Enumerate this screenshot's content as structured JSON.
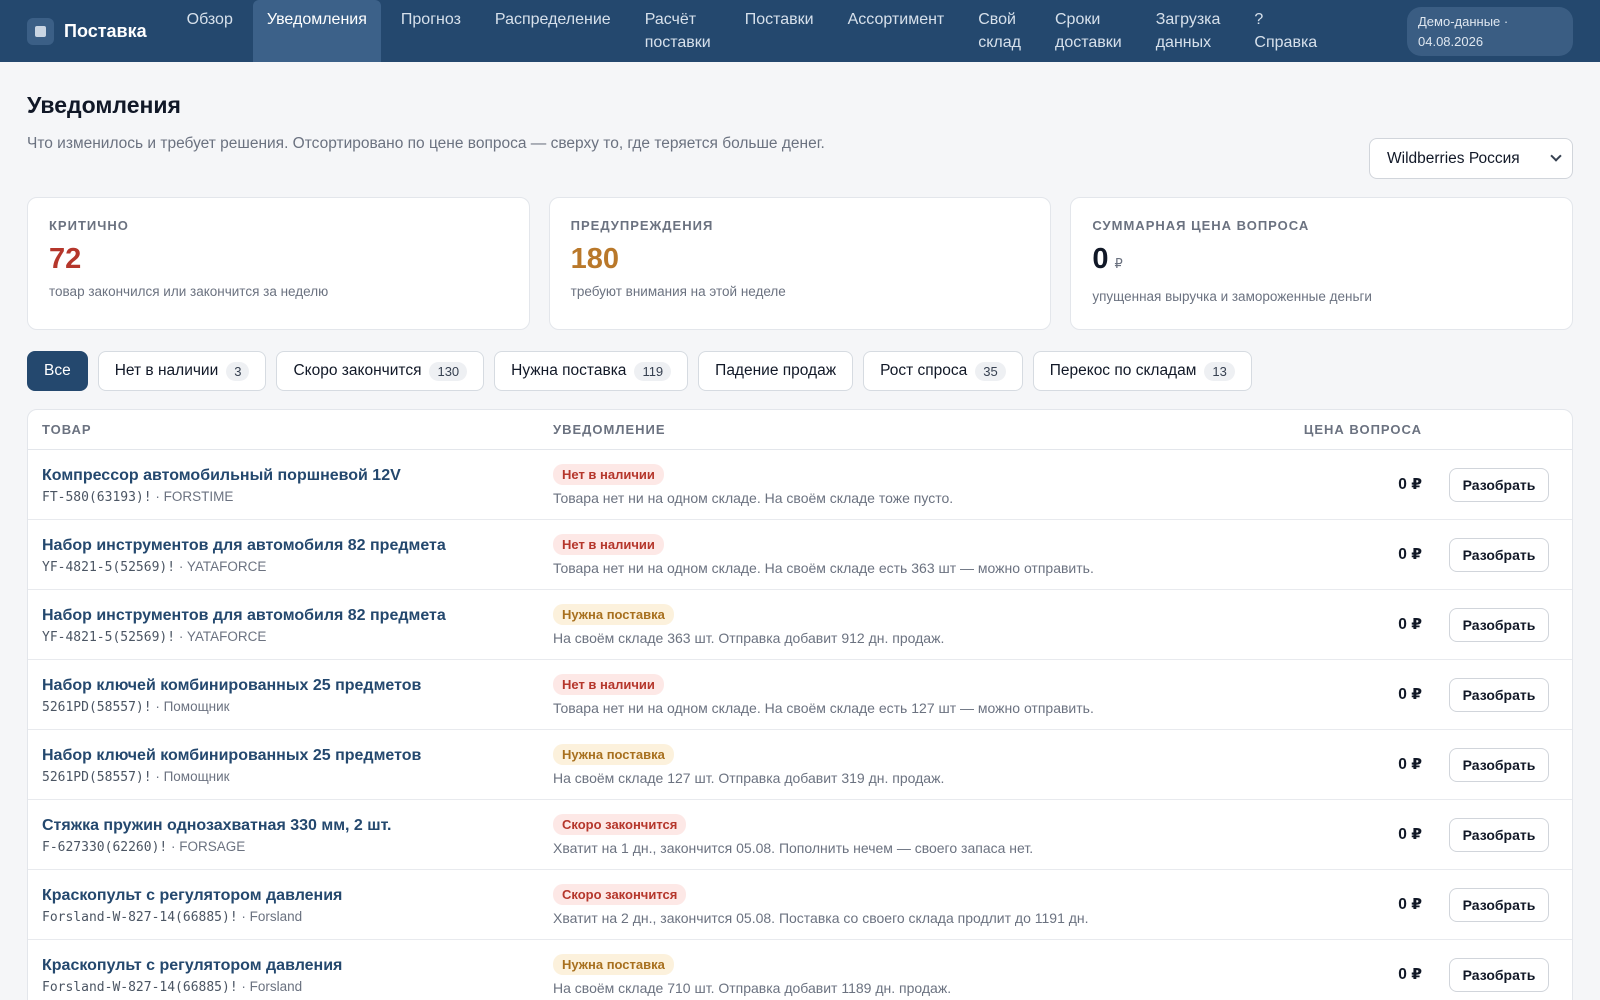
{
  "app": {
    "brand": "Поставка",
    "nav": [
      {
        "lines": [
          "Обзор"
        ],
        "active": false
      },
      {
        "lines": [
          "Уведомления"
        ],
        "active": true
      },
      {
        "lines": [
          "Прогноз"
        ],
        "active": false
      },
      {
        "lines": [
          "Распределение"
        ],
        "active": false
      },
      {
        "lines": [
          "Расчёт",
          "поставки"
        ],
        "active": false
      },
      {
        "lines": [
          "Поставки"
        ],
        "active": false
      },
      {
        "lines": [
          "Ассортимент"
        ],
        "active": false
      },
      {
        "lines": [
          "Свой",
          "склад"
        ],
        "active": false
      },
      {
        "lines": [
          "Сроки",
          "доставки"
        ],
        "active": false
      },
      {
        "lines": [
          "Загрузка",
          "данных"
        ],
        "active": false
      },
      {
        "lines": [
          "?",
          "Справка"
        ],
        "active": false
      }
    ],
    "demo_badge": [
      "Демо-данные ·",
      "04.08.2026"
    ]
  },
  "page": {
    "title": "Уведомления",
    "subtitle": "Что изменилось и требует решения. Отсортировано по цене вопроса — сверху то, где теряется больше денег.",
    "marketplace_select": "Wildberries Россия"
  },
  "cards": [
    {
      "label": "Критично",
      "value": "72",
      "unit": "",
      "desc": "товар закончился или закончится за неделю",
      "tone": "red"
    },
    {
      "label": "Предупреждения",
      "value": "180",
      "unit": "",
      "desc": "требуют внимания на этой неделе",
      "tone": "orange"
    },
    {
      "label": "Суммарная цена вопроса",
      "value": "0",
      "unit": "₽",
      "desc": "упущенная выручка и замороженные деньги",
      "tone": "dark"
    }
  ],
  "filters": [
    {
      "label": "Все",
      "count": "",
      "active": true
    },
    {
      "label": "Нет в наличии",
      "count": "3",
      "active": false
    },
    {
      "label": "Скоро закончится",
      "count": "130",
      "active": false
    },
    {
      "label": "Нужна поставка",
      "count": "119",
      "active": false
    },
    {
      "label": "Падение продаж",
      "count": "",
      "active": false
    },
    {
      "label": "Рост спроса",
      "count": "35",
      "active": false
    },
    {
      "label": "Перекос по складам",
      "count": "13",
      "active": false
    }
  ],
  "table": {
    "headers": {
      "item": "ТОВАР",
      "note": "УВЕДОМЛЕНИЕ",
      "price": "ЦЕНА ВОПРОСА"
    },
    "action_label": "Разобрать",
    "rows": [
      {
        "name": "Компрессор автомобильный поршневой 12V",
        "sku": "FT-580(63193)!",
        "brand": "FORSTIME",
        "badge": "Нет в наличии",
        "badge_tone": "red",
        "note": "Товара нет ни на одном складе. На своём складе тоже пусто.",
        "price": "0 ₽"
      },
      {
        "name": "Набор инструментов для автомобиля 82 предмета",
        "sku": "YF-4821-5(52569)!",
        "brand": "YATAFORCE",
        "badge": "Нет в наличии",
        "badge_tone": "red",
        "note": "Товара нет ни на одном складе. На своём складе есть 363 шт — можно отправить.",
        "price": "0 ₽"
      },
      {
        "name": "Набор инструментов для автомобиля 82 предмета",
        "sku": "YF-4821-5(52569)!",
        "brand": "YATAFORCE",
        "badge": "Нужна поставка",
        "badge_tone": "amber",
        "note": "На своём складе 363 шт. Отправка добавит 912 дн. продаж.",
        "price": "0 ₽"
      },
      {
        "name": "Набор ключей комбинированных 25 предметов",
        "sku": "5261PD(58557)!",
        "brand": "Помощник",
        "badge": "Нет в наличии",
        "badge_tone": "red",
        "note": "Товара нет ни на одном складе. На своём складе есть 127 шт — можно отправить.",
        "price": "0 ₽"
      },
      {
        "name": "Набор ключей комбинированных 25 предметов",
        "sku": "5261PD(58557)!",
        "brand": "Помощник",
        "badge": "Нужна поставка",
        "badge_tone": "amber",
        "note": "На своём складе 127 шт. Отправка добавит 319 дн. продаж.",
        "price": "0 ₽"
      },
      {
        "name": "Стяжка пружин однозахватная 330 мм, 2 шт.",
        "sku": "F-627330(62260)!",
        "brand": "FORSAGE",
        "badge": "Скоро закончится",
        "badge_tone": "red",
        "note": "Хватит на 1 дн., закончится 05.08. Пополнить нечем — своего запаса нет.",
        "price": "0 ₽"
      },
      {
        "name": "Краскопульт с регулятором давления",
        "sku": "Forsland-W-827-14(66885)!",
        "brand": "Forsland",
        "badge": "Скоро закончится",
        "badge_tone": "red",
        "note": "Хватит на 2 дн., закончится 05.08. Поставка со своего склада продлит до 1191 дн.",
        "price": "0 ₽"
      },
      {
        "name": "Краскопульт с регулятором давления",
        "sku": "Forsland-W-827-14(66885)!",
        "brand": "Forsland",
        "badge": "Нужна поставка",
        "badge_tone": "amber",
        "note": "На своём складе 710 шт. Отправка добавит 1189 дн. продаж.",
        "price": "0 ₽"
      }
    ]
  }
}
